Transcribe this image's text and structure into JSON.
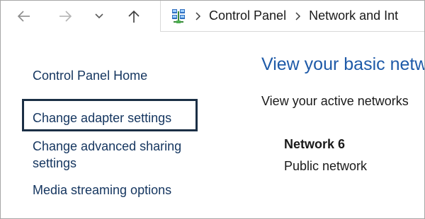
{
  "navigation": {
    "back_icon": "arrow-left-icon",
    "forward_icon": "arrow-right-icon",
    "recent_icon": "chevron-down-icon",
    "up_icon": "arrow-up-icon"
  },
  "address_bar": {
    "location_icon": "network-icon",
    "separator_icon": "chevron-right-icon",
    "breadcrumbs": [
      "Control Panel",
      "Network and Int"
    ]
  },
  "left_pane": {
    "links": [
      "Control Panel Home",
      "Change adapter settings",
      "Change advanced sharing settings",
      "Media streaming options"
    ]
  },
  "main_pane": {
    "title": "View your basic netw",
    "subtitle": "View your active networks",
    "network": {
      "name": "Network 6",
      "type": "Public network"
    }
  },
  "colors": {
    "link": "#14355f",
    "title": "#1e5aa8",
    "focus_border": "#1b2f45",
    "nav_icon_disabled": "#a0a0a0",
    "nav_icon_enabled": "#3c3c3c"
  }
}
